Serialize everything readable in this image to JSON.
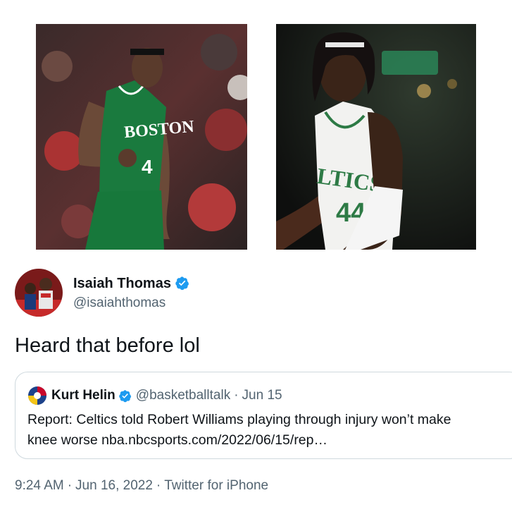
{
  "media": {
    "left_photo": {
      "jersey_text": "BOSTON",
      "jersey_number": "4"
    },
    "right_photo": {
      "jersey_text": "CELTICS",
      "jersey_number": "44"
    }
  },
  "author": {
    "name": "Isaiah Thomas",
    "handle": "@isaiahthomas"
  },
  "tweet": {
    "text": "Heard that before lol"
  },
  "quote": {
    "name": "Kurt Helin",
    "handle": "@basketballtalk",
    "separator": "·",
    "date": "Jun 15",
    "text_line1": "Report: Celtics told Robert Williams playing through injury won’t make",
    "text_line2": "knee worse nba.nbcsports.com/2022/06/15/rep…"
  },
  "meta": {
    "time": "9:24 AM",
    "separator": "·",
    "date": "Jun 16, 2022",
    "source": "Twitter for iPhone"
  },
  "colors": {
    "verified": "#1d9bf0",
    "secondary_text": "#536471",
    "border": "#cfd9de",
    "celtics_green": "#1a7a3e"
  }
}
